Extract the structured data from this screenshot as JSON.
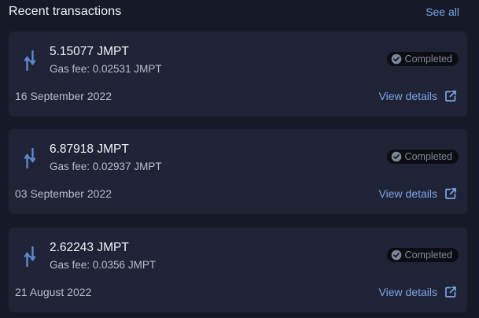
{
  "header": {
    "title": "Recent transactions",
    "see_all": "See all"
  },
  "transactions": [
    {
      "amount": "5.15077 JMPT",
      "gas_fee": "Gas fee: 0.02531 JMPT",
      "status": "Completed",
      "date": "16 September 2022",
      "action": "View details"
    },
    {
      "amount": "6.87918 JMPT",
      "gas_fee": "Gas fee: 0.02937 JMPT",
      "status": "Completed",
      "date": "03 September 2022",
      "action": "View details"
    },
    {
      "amount": "2.62243 JMPT",
      "gas_fee": "Gas fee: 0.0356 JMPT",
      "status": "Completed",
      "date": "21 August 2022",
      "action": "View details"
    }
  ],
  "icons": {
    "transaction": "transfer-arrow-icon",
    "status": "check-circle-icon",
    "details": "external-link-icon"
  },
  "colors": {
    "background": "#161a28",
    "card": "#1f2335",
    "accent": "#7aa4e8",
    "badge": "#0b0d13",
    "muted_text": "#b7bdcb"
  }
}
